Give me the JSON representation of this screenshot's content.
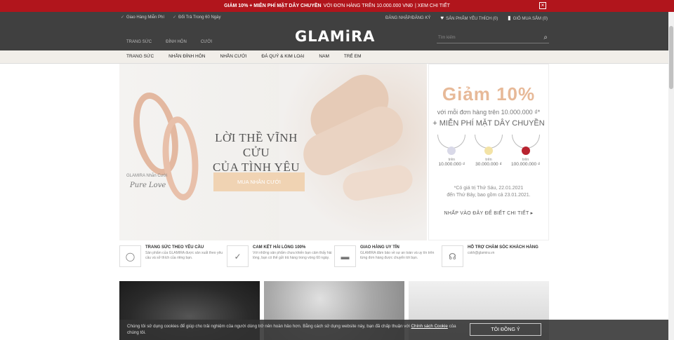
{
  "promo": {
    "bold": "GIẢM 10% + MIỄN PHÍ MẶT DÂY CHUYỀN",
    "rest": "VỚI ĐƠN HÀNG TRÊN 10.000.000 VNĐ",
    "link": "| XEM CHI TIẾT",
    "close": "×"
  },
  "header": {
    "util_left": [
      "Giao Hàng Miễn Phí",
      "Đổi Trả Trong 60 Ngày"
    ],
    "login": "ĐĂNG NHẬP/ĐĂNG KÝ",
    "wishlist": "SẢN PHẨM YÊU THÍCH (0)",
    "cart": "GIỎ MUA SẮM (0)",
    "logo": "GLAMiRA",
    "top_links": [
      "TRANG SỨC",
      "ĐÍNH HÔN",
      "CƯỚI"
    ],
    "search_placeholder": "Tìm kiếm"
  },
  "nav": {
    "items": [
      "TRANG SỨC",
      "NHẪN ĐÍNH HÔN",
      "NHẪN CƯỚI",
      "ĐÁ QUÝ & KIM LOẠI",
      "NAM",
      "TRẺ EM"
    ]
  },
  "hero": {
    "title_line1": "LỜI THỀ VĨNH CỬU",
    "title_line2": "CỦA TÌNH YÊU",
    "button": "MUA NHẪN CƯỚI",
    "caption": "GLAMIRA Nhẫn Cưới",
    "script": "Pure Love"
  },
  "side_promo": {
    "title": "Giảm 10%",
    "sub": "với mỗi đơn hàng trên 10.000.000 ₫*",
    "sub2": "+ MIỄN PHÍ MẶT DÂY CHUYỀN",
    "pendants": [
      {
        "label": "trên",
        "price": "10.000.000 ₫",
        "color": "#d9d9e8"
      },
      {
        "label": "trên",
        "price": "30.000.000 ₫",
        "color": "#f3e3a6"
      },
      {
        "label": "trên",
        "price": "100.000.000 ₫",
        "color": "#b8232f"
      }
    ],
    "date1": "*Có giá trị Thứ Sáu, 22.01.2021",
    "date2": "đến Thứ Bảy, bao gồm cả 23.01.2021.",
    "link": "NHẤP VÀO ĐÂY ĐỂ BIẾT CHI TIẾT ▸"
  },
  "features": [
    {
      "title": "TRANG SỨC THEO YÊU CẦU",
      "desc": "Sản phẩm của GLAMIRA được sản xuất theo yêu cầu và sở thích của riêng bạn.",
      "icon": "ring-icon"
    },
    {
      "title": "CAM KẾT HÀI LÒNG 100%",
      "desc": "Với những sản phẩm chưa khiến bạn cảm thấy hài lòng, bạn có thể gửi trả hàng trong vòng 60 ngày.",
      "icon": "check-icon"
    },
    {
      "title": "GIAO HÀNG UY TÍN",
      "desc": "GLAMIRA đảm bảo về sự an toàn và uy tín trên từng đơn hàng được chuyển tới bạn.",
      "icon": "truck-icon"
    },
    {
      "title": "HỖ TRỢ CHĂM SÓC KHÁCH HÀNG",
      "desc": "cskh@glamira.vn",
      "icon": "headset-icon"
    }
  ],
  "cookie": {
    "text": "Chúng tôi sử dụng cookies để giúp cho trải nghiệm của người dùng trở nên hoàn hảo hơn. Bằng cách sử dụng website này, bạn đã chấp thuận với",
    "link": "Chính sách Cookie",
    "text2": "của chúng tôi.",
    "button": "TÔI ĐỒNG Ý"
  }
}
